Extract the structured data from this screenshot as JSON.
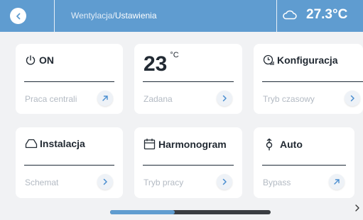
{
  "header": {
    "breadcrumb_parent": "Wentylacja/",
    "breadcrumb_current": "Ustawienia",
    "temperature": "27.3°C",
    "weather_icon": "cloud-icon",
    "accent_color": "#5f9cd0"
  },
  "cards": {
    "power": {
      "title": "ON",
      "subtitle": "Praca centrali",
      "icon": "power-icon",
      "action_icon": "arrow-up-right-icon"
    },
    "setpoint": {
      "value": "23",
      "unit": "°C",
      "subtitle": "Zadana",
      "action_icon": "chevron-right-icon"
    },
    "config": {
      "title": "Konfiguracja",
      "subtitle": "Tryb czasowy",
      "icon": "clock-signal-icon",
      "action_icon": "chevron-right-icon"
    },
    "install": {
      "title": "Instalacja",
      "subtitle": "Schemat",
      "icon": "house-outline-icon",
      "action_icon": "chevron-right-icon"
    },
    "schedule": {
      "title": "Harmonogram",
      "subtitle": "Tryb pracy",
      "icon": "calendar-icon",
      "action_icon": "chevron-right-icon"
    },
    "bypass": {
      "title": "Auto",
      "subtitle": "Bypass",
      "icon": "bypass-valve-icon",
      "action_icon": "arrow-up-right-icon"
    }
  },
  "pager": {
    "position": 0.4
  }
}
